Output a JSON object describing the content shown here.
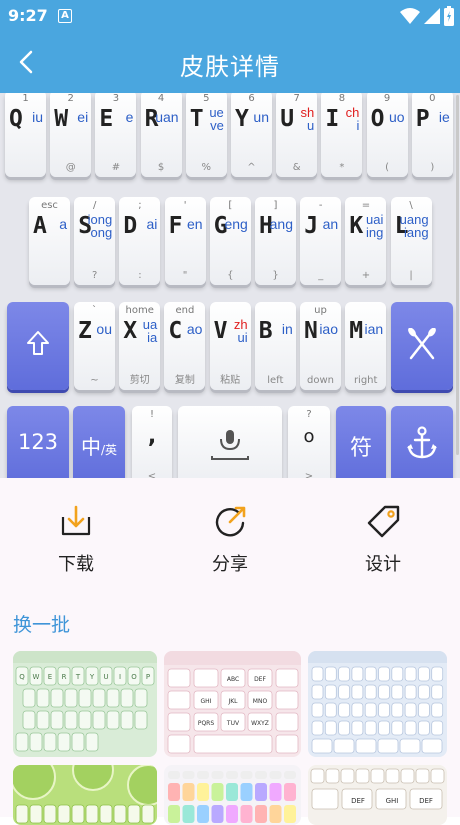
{
  "status_bar": {
    "time": "9:27",
    "app_badge": "A"
  },
  "app_bar": {
    "title": "皮肤详情"
  },
  "keyboard_preview": {
    "row1": [
      {
        "top": "1",
        "main": "Q",
        "py": "iu",
        "bot": ""
      },
      {
        "top": "2",
        "main": "W",
        "py": "ei",
        "bot": "@"
      },
      {
        "top": "3",
        "main": "E",
        "py": "e",
        "bot": "#"
      },
      {
        "top": "4",
        "main": "R",
        "py": "uan",
        "bot": "$"
      },
      {
        "top": "5",
        "main": "T",
        "py": "ue ve",
        "bot": "%"
      },
      {
        "top": "6",
        "main": "Y",
        "py": "un",
        "bot": "^"
      },
      {
        "top": "7",
        "main": "U",
        "py": "sh u",
        "bot": "&"
      },
      {
        "top": "8",
        "main": "I",
        "py": "ch i",
        "bot": "*"
      },
      {
        "top": "9",
        "main": "O",
        "py": "uo",
        "bot": "("
      },
      {
        "top": "0",
        "main": "P",
        "py": "ie",
        "bot": ")"
      }
    ],
    "row2": [
      {
        "top": "esc",
        "main": "A",
        "py": "a",
        "bot": ""
      },
      {
        "top": "/",
        "main": "S",
        "py": "iong ong",
        "bot": "?"
      },
      {
        "top": ";",
        "main": "D",
        "py": "ai",
        "bot": ":"
      },
      {
        "top": "'",
        "main": "F",
        "py": "en",
        "bot": "\""
      },
      {
        "top": "[",
        "main": "G",
        "py": "eng",
        "bot": "{"
      },
      {
        "top": "]",
        "main": "H",
        "py": "ang",
        "bot": "}"
      },
      {
        "top": "-",
        "main": "J",
        "py": "an",
        "bot": "_"
      },
      {
        "top": "=",
        "main": "K",
        "py": "uai ing",
        "bot": "+"
      },
      {
        "top": "\\",
        "main": "L",
        "py": "uang iang",
        "bot": "|"
      }
    ],
    "row3": [
      {
        "top": "`",
        "main": "Z",
        "py": "ou",
        "bot": "~"
      },
      {
        "top": "home",
        "main": "X",
        "py": "ua ia",
        "bot": "剪切"
      },
      {
        "top": "end",
        "main": "C",
        "py": "ao",
        "bot": "复制"
      },
      {
        "top": "",
        "main": "V",
        "py": "zh ui",
        "bot": "粘贴"
      },
      {
        "top": "",
        "main": "B",
        "py": "in",
        "bot": "left"
      },
      {
        "top": "up",
        "main": "N",
        "py": "iao",
        "bot": "down"
      },
      {
        "top": "",
        "main": "M",
        "py": "ian",
        "bot": "right"
      }
    ],
    "row4": {
      "num_label": "123",
      "lang_label": "中",
      "lang_sub": "/英",
      "comma_top": "!",
      "comma_main": ",",
      "comma_bot": "<",
      "period_top": "?",
      "period_main": "o",
      "period_bot": ">",
      "symbol_label": "符"
    }
  },
  "actions": {
    "download": "下载",
    "share": "分享",
    "design": "设计"
  },
  "recommend": {
    "heading": "换一批",
    "thumb_keys": {
      "pink": [
        "ABC",
        "DEF",
        "GHI",
        "JKL",
        "MNO",
        "PQRS",
        "TUV",
        "WXYZ"
      ],
      "green_letters": "QWERTYUIOP",
      "rainbow_keys": [
        "DEF",
        "GHI",
        "DEF"
      ]
    }
  },
  "colors": {
    "app_bar": "#4aa6df",
    "accent_blue": "#3f95d8",
    "key_blue": "#5f6ddb",
    "pinyin_blue": "#2d5fc7",
    "pinyin_red": "#e02020"
  }
}
